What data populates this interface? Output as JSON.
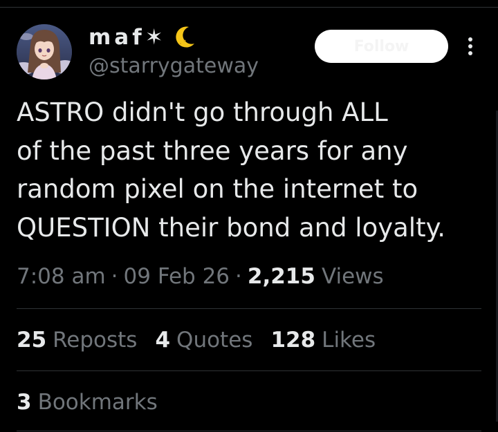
{
  "author": {
    "display_name": "maf✶",
    "name_emoji": "crescent-moon",
    "handle": "@starrygateway",
    "avatar_icon": "anime-girl-avatar"
  },
  "follow_button": {
    "label": "Follow"
  },
  "tweet": {
    "text_lines": [
      "ASTRO didn't go through ALL",
      "of the past three years for any",
      "random pixel on the internet to",
      "QUESTION their bond and loyalty."
    ]
  },
  "meta": {
    "time": "7:08 am",
    "separator": "·",
    "date": "09 Feb 26",
    "views_count": "2,215",
    "views_label": "Views"
  },
  "stats": {
    "reposts": {
      "count": "25",
      "label": "Reposts"
    },
    "quotes": {
      "count": "4",
      "label": "Quotes"
    },
    "likes": {
      "count": "128",
      "label": "Likes"
    },
    "bookmarks": {
      "count": "3",
      "label": "Bookmarks"
    }
  },
  "colors": {
    "background": "#000000",
    "text_primary": "#e7e9ea",
    "text_secondary": "#71767b",
    "divider": "#2f3336",
    "follow_button_bg": "#ffffff",
    "moon": "#f5c518"
  }
}
